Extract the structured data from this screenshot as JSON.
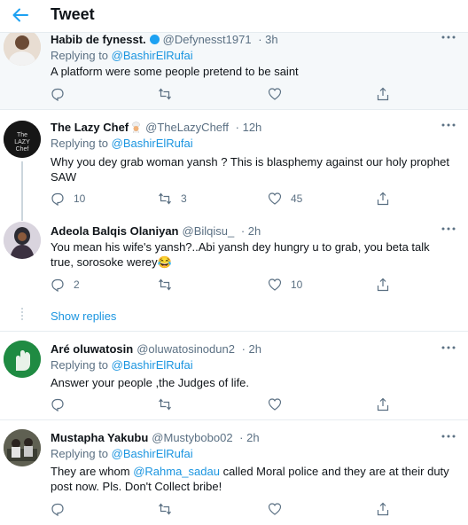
{
  "header": {
    "title": "Tweet"
  },
  "replying_label": "Replying to",
  "tweets": [
    {
      "name": "Habib de fynesst.",
      "handle": "@Defynesst1971",
      "time": "· 3h",
      "reply_to": "@BashirElRufai",
      "text": "A platform were some people  pretend to be saint",
      "replies": "",
      "retweets": "",
      "likes": ""
    },
    {
      "name": "The Lazy Chef",
      "handle": "@TheLazyCheff",
      "time": "· 12h",
      "reply_to": "@BashirElRufai",
      "text": "Why you dey grab woman yansh ? This is blasphemy against our holy prophet SAW",
      "replies": "10",
      "retweets": "3",
      "likes": "45",
      "avatar_text": "The LAZY Chef"
    },
    {
      "name": "Adeola Balqis Olaniyan",
      "handle": "@Bilqisu_",
      "time": "· 2h",
      "reply_to": "",
      "text": "You mean his wife's yansh?..Abi yansh dey hungry u to grab, you beta talk true, sorosoke werey😂",
      "replies": "2",
      "retweets": "",
      "likes": "10"
    },
    {
      "name": "Aré oluwatosin",
      "handle": "@oluwatosinodun2",
      "time": "· 2h",
      "reply_to": "@BashirElRufai",
      "text": "Answer your people ,the Judges of life.",
      "replies": "",
      "retweets": "",
      "likes": ""
    },
    {
      "name": "Mustapha Yakubu",
      "handle": "@Mustybobo02",
      "time": "· 2h",
      "reply_to": "@BashirElRufai",
      "text_before": "They are whom ",
      "mention": "@Rahma_sadau",
      "text_after": "  called  Moral police and they are at their duty post now. Pls.  Don't Collect bribe!",
      "replies": "",
      "retweets": "",
      "likes": ""
    }
  ],
  "show_replies": "Show replies",
  "colors": {
    "link": "#1b95e0",
    "muted": "#5b7083",
    "divider": "#e6ecf0",
    "verified": "#1da1f2"
  }
}
